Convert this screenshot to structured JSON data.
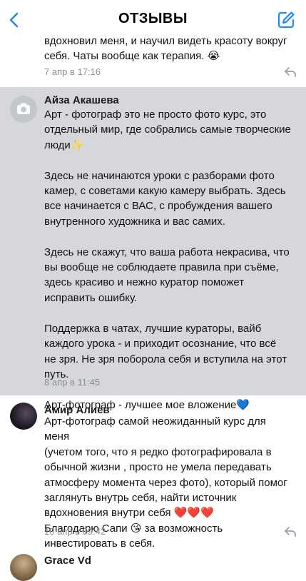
{
  "header": {
    "title": "ОТЗЫВЫ",
    "back_icon": "chevron-left-icon",
    "compose_icon": "compose-edit-icon",
    "accent_color": "#2787f5"
  },
  "reviews": [
    {
      "text": "вдохновил меня, и научил видеть красоту вокруг\nсебя. Чаты вообще как терапия. 😭",
      "date": "7 апр в 17:16"
    },
    {
      "author": "Айза Акашева",
      "avatar": "camera-placeholder-icon",
      "highlighted": true,
      "text": "Арт - фотограф это не просто фото курс, это\nотдельный мир, где собрались самые творческие\nлюди✨\n\nЗдесь не начинаются уроки с разборами фото\nкамер, с советами какую камеру выбрать. Здесь\nвсе начинается с ВАС, с пробуждения вашего\nвнутренного художника и вас самих.\n\nЗдесь не скажут, что ваша работа некрасива, что\nвы вообще не соблюдаете правила при съёме,\nздесь красиво и нежно куратор поможет\nисправить ошибку.\n\nПоддержка в чатах, лучшие кураторы, вайб\nкаждого урока - и приходит осознание, что всё\nне зря. Не зря поборола себя и вступила на этот\nпуть.\n\nАрт-фотограф - лучшее мое вложение💙",
      "date": "8 апр в 11:45"
    },
    {
      "author": "Амир Алиев",
      "avatar": "user-photo-avatar",
      "text": "Арт-фотограф самой неожиданный курс для меня\n(учетом того, что я редко фотографировала в\nобычной жизни , просто не умела передавать\nатмосферу момента через фото), который помог\nзаглянуть внутрь себя, найти источник\nвдохновения внутри себя ❤️❤️❤️\nБлагодарю Сапи 😘 за возможность\nинвестировать в себя.",
      "date": "10 апр в 09:42"
    },
    {
      "author": "Grace Vd",
      "avatar": "user-photo-avatar"
    }
  ]
}
